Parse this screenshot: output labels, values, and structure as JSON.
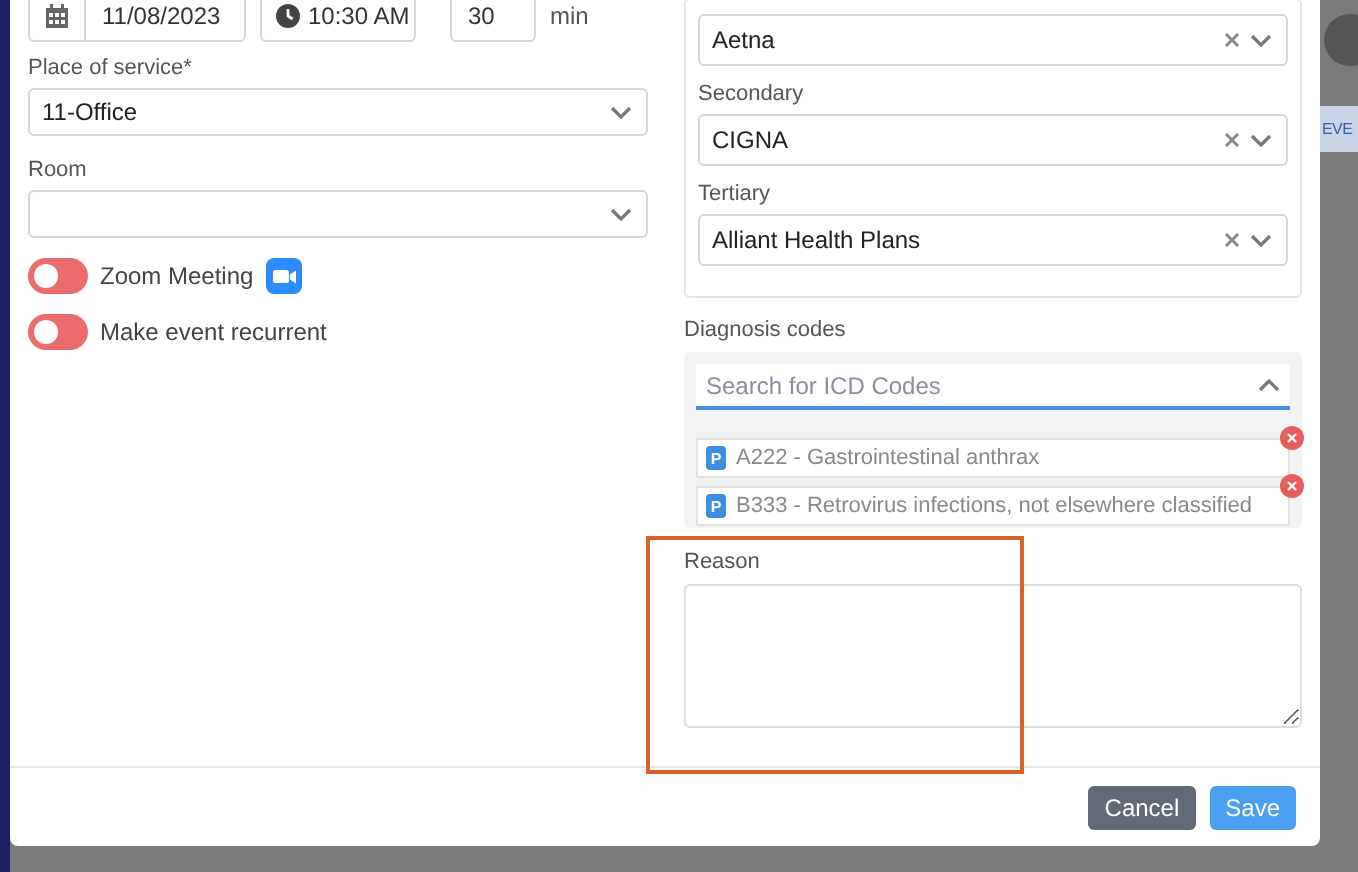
{
  "schedule": {
    "date": "11/08/2023",
    "time": "10:30 AM",
    "duration": "30",
    "duration_unit": "min"
  },
  "place_of_service": {
    "label": "Place of service*",
    "value": "11-Office"
  },
  "room": {
    "label": "Room"
  },
  "toggles": [
    {
      "label": "Zoom Meeting",
      "on": false,
      "kind": "video"
    },
    {
      "label": "Make event recurrent",
      "on": false,
      "kind": "plain"
    }
  ],
  "insurance": [
    {
      "value": "Aetna"
    },
    {
      "label": "Secondary",
      "value": "CIGNA"
    },
    {
      "label": "Tertiary",
      "value": "Alliant Health Plans"
    }
  ],
  "diagnosis": {
    "label": "Diagnosis codes",
    "placeholder": "Search for ICD Codes",
    "codes": [
      {
        "badge": "P",
        "text": "A222 - Gastrointestinal anthrax"
      },
      {
        "badge": "P",
        "text": "B333 - Retrovirus infections, not elsewhere classified"
      }
    ]
  },
  "reason": {
    "label": "Reason"
  },
  "buttons": [
    {
      "label": "Cancel",
      "kind": "secondary"
    },
    {
      "label": "Save",
      "kind": "primary"
    }
  ],
  "background": {
    "tab": "EVE"
  }
}
